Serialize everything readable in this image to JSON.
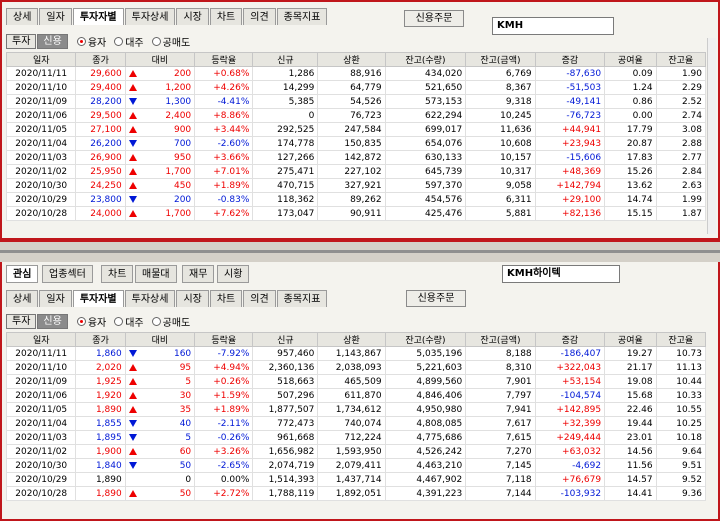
{
  "colors": {
    "up": "#e00000",
    "down": "#0018d6",
    "frame": "#c0161b"
  },
  "panel1": {
    "tabs": [
      "상세",
      "일자",
      "투자자별",
      "투자상세",
      "시장",
      "차트",
      "의견",
      "종목지표"
    ],
    "credit_button": "신용주문",
    "stock_name": "KMH",
    "filter_buttons": [
      "투자",
      "신용"
    ],
    "radios": [
      "융자",
      "대주",
      "공매도"
    ],
    "columns": [
      "일자",
      "종가",
      "대비",
      "등락율",
      "신규",
      "상환",
      "잔고(수량)",
      "잔고(금액)",
      "증감",
      "공여율",
      "잔고율"
    ],
    "rows": [
      {
        "date": "2020/11/11",
        "close": "29,600",
        "dir": "up",
        "change": "200",
        "rate": "+0.68%",
        "new": "1,286",
        "repay": "88,916",
        "bal_qty": "434,020",
        "bal_amt": "6,769",
        "delta": "-87,630",
        "supply": "0.09",
        "ratio": "1.90"
      },
      {
        "date": "2020/11/10",
        "close": "29,400",
        "dir": "up",
        "change": "1,200",
        "rate": "+4.26%",
        "new": "14,299",
        "repay": "64,779",
        "bal_qty": "521,650",
        "bal_amt": "8,367",
        "delta": "-51,503",
        "supply": "1.24",
        "ratio": "2.29"
      },
      {
        "date": "2020/11/09",
        "close": "28,200",
        "dir": "down",
        "change": "1,300",
        "rate": "-4.41%",
        "new": "5,385",
        "repay": "54,526",
        "bal_qty": "573,153",
        "bal_amt": "9,318",
        "delta": "-49,141",
        "supply": "0.86",
        "ratio": "2.52"
      },
      {
        "date": "2020/11/06",
        "close": "29,500",
        "dir": "up",
        "change": "2,400",
        "rate": "+8.86%",
        "new": "0",
        "repay": "76,723",
        "bal_qty": "622,294",
        "bal_amt": "10,245",
        "delta": "-76,723",
        "supply": "0.00",
        "ratio": "2.74"
      },
      {
        "date": "2020/11/05",
        "close": "27,100",
        "dir": "up",
        "change": "900",
        "rate": "+3.44%",
        "new": "292,525",
        "repay": "247,584",
        "bal_qty": "699,017",
        "bal_amt": "11,636",
        "delta": "+44,941",
        "supply": "17.79",
        "ratio": "3.08"
      },
      {
        "date": "2020/11/04",
        "close": "26,200",
        "dir": "down",
        "change": "700",
        "rate": "-2.60%",
        "new": "174,778",
        "repay": "150,835",
        "bal_qty": "654,076",
        "bal_amt": "10,608",
        "delta": "+23,943",
        "supply": "20.87",
        "ratio": "2.88"
      },
      {
        "date": "2020/11/03",
        "close": "26,900",
        "dir": "up",
        "change": "950",
        "rate": "+3.66%",
        "new": "127,266",
        "repay": "142,872",
        "bal_qty": "630,133",
        "bal_amt": "10,157",
        "delta": "-15,606",
        "supply": "17.83",
        "ratio": "2.77"
      },
      {
        "date": "2020/11/02",
        "close": "25,950",
        "dir": "up",
        "change": "1,700",
        "rate": "+7.01%",
        "new": "275,471",
        "repay": "227,102",
        "bal_qty": "645,739",
        "bal_amt": "10,317",
        "delta": "+48,369",
        "supply": "15.26",
        "ratio": "2.84"
      },
      {
        "date": "2020/10/30",
        "close": "24,250",
        "dir": "up",
        "change": "450",
        "rate": "+1.89%",
        "new": "470,715",
        "repay": "327,921",
        "bal_qty": "597,370",
        "bal_amt": "9,058",
        "delta": "+142,794",
        "supply": "13.62",
        "ratio": "2.63"
      },
      {
        "date": "2020/10/29",
        "close": "23,800",
        "dir": "down",
        "change": "200",
        "rate": "-0.83%",
        "new": "118,362",
        "repay": "89,262",
        "bal_qty": "454,576",
        "bal_amt": "6,311",
        "delta": "+29,100",
        "supply": "14.74",
        "ratio": "1.99"
      },
      {
        "date": "2020/10/28",
        "close": "24,000",
        "dir": "up",
        "change": "1,700",
        "rate": "+7.62%",
        "new": "173,047",
        "repay": "90,911",
        "bal_qty": "425,476",
        "bal_amt": "5,881",
        "delta": "+82,136",
        "supply": "15.15",
        "ratio": "1.87"
      }
    ]
  },
  "upper_tabs": [
    "관심",
    "업종섹터",
    "차트",
    "매물대",
    "재무",
    "시황"
  ],
  "panel2": {
    "tabs": [
      "상세",
      "일자",
      "투자자별",
      "투자상세",
      "시장",
      "차트",
      "의견",
      "종목지표"
    ],
    "credit_button": "신용주문",
    "stock_name": "KMH하이텍",
    "filter_buttons": [
      "투자",
      "신용"
    ],
    "radios": [
      "융자",
      "대주",
      "공매도"
    ],
    "columns": [
      "일자",
      "종가",
      "대비",
      "등락율",
      "신규",
      "상환",
      "잔고(수량)",
      "잔고(금액)",
      "증감",
      "공여율",
      "잔고율"
    ],
    "rows": [
      {
        "date": "2020/11/11",
        "close": "1,860",
        "dir": "down",
        "change": "160",
        "rate": "-7.92%",
        "new": "957,460",
        "repay": "1,143,867",
        "bal_qty": "5,035,196",
        "bal_amt": "8,188",
        "delta": "-186,407",
        "supply": "19.27",
        "ratio": "10.73"
      },
      {
        "date": "2020/11/10",
        "close": "2,020",
        "dir": "up",
        "change": "95",
        "rate": "+4.94%",
        "new": "2,360,136",
        "repay": "2,038,093",
        "bal_qty": "5,221,603",
        "bal_amt": "8,310",
        "delta": "+322,043",
        "supply": "21.17",
        "ratio": "11.13"
      },
      {
        "date": "2020/11/09",
        "close": "1,925",
        "dir": "up",
        "change": "5",
        "rate": "+0.26%",
        "new": "518,663",
        "repay": "465,509",
        "bal_qty": "4,899,560",
        "bal_amt": "7,901",
        "delta": "+53,154",
        "supply": "19.08",
        "ratio": "10.44"
      },
      {
        "date": "2020/11/06",
        "close": "1,920",
        "dir": "up",
        "change": "30",
        "rate": "+1.59%",
        "new": "507,296",
        "repay": "611,870",
        "bal_qty": "4,846,406",
        "bal_amt": "7,797",
        "delta": "-104,574",
        "supply": "15.68",
        "ratio": "10.33"
      },
      {
        "date": "2020/11/05",
        "close": "1,890",
        "dir": "up",
        "change": "35",
        "rate": "+1.89%",
        "new": "1,877,507",
        "repay": "1,734,612",
        "bal_qty": "4,950,980",
        "bal_amt": "7,941",
        "delta": "+142,895",
        "supply": "22.46",
        "ratio": "10.55"
      },
      {
        "date": "2020/11/04",
        "close": "1,855",
        "dir": "down",
        "change": "40",
        "rate": "-2.11%",
        "new": "772,473",
        "repay": "740,074",
        "bal_qty": "4,808,085",
        "bal_amt": "7,617",
        "delta": "+32,399",
        "supply": "19.44",
        "ratio": "10.25"
      },
      {
        "date": "2020/11/03",
        "close": "1,895",
        "dir": "down",
        "change": "5",
        "rate": "-0.26%",
        "new": "961,668",
        "repay": "712,224",
        "bal_qty": "4,775,686",
        "bal_amt": "7,615",
        "delta": "+249,444",
        "supply": "23.01",
        "ratio": "10.18"
      },
      {
        "date": "2020/11/02",
        "close": "1,900",
        "dir": "up",
        "change": "60",
        "rate": "+3.26%",
        "new": "1,656,982",
        "repay": "1,593,950",
        "bal_qty": "4,526,242",
        "bal_amt": "7,270",
        "delta": "+63,032",
        "supply": "14.56",
        "ratio": "9.64"
      },
      {
        "date": "2020/10/30",
        "close": "1,840",
        "dir": "down",
        "change": "50",
        "rate": "-2.65%",
        "new": "2,074,719",
        "repay": "2,079,411",
        "bal_qty": "4,463,210",
        "bal_amt": "7,145",
        "delta": "-4,692",
        "supply": "11.56",
        "ratio": "9.51"
      },
      {
        "date": "2020/10/29",
        "close": "1,890",
        "dir": "flat",
        "change": "0",
        "rate": "0.00%",
        "new": "1,514,393",
        "repay": "1,437,714",
        "bal_qty": "4,467,902",
        "bal_amt": "7,118",
        "delta": "+76,679",
        "supply": "14.57",
        "ratio": "9.52"
      },
      {
        "date": "2020/10/28",
        "close": "1,890",
        "dir": "up",
        "change": "50",
        "rate": "+2.72%",
        "new": "1,788,119",
        "repay": "1,892,051",
        "bal_qty": "4,391,223",
        "bal_amt": "7,144",
        "delta": "-103,932",
        "supply": "14.41",
        "ratio": "9.36"
      }
    ]
  }
}
